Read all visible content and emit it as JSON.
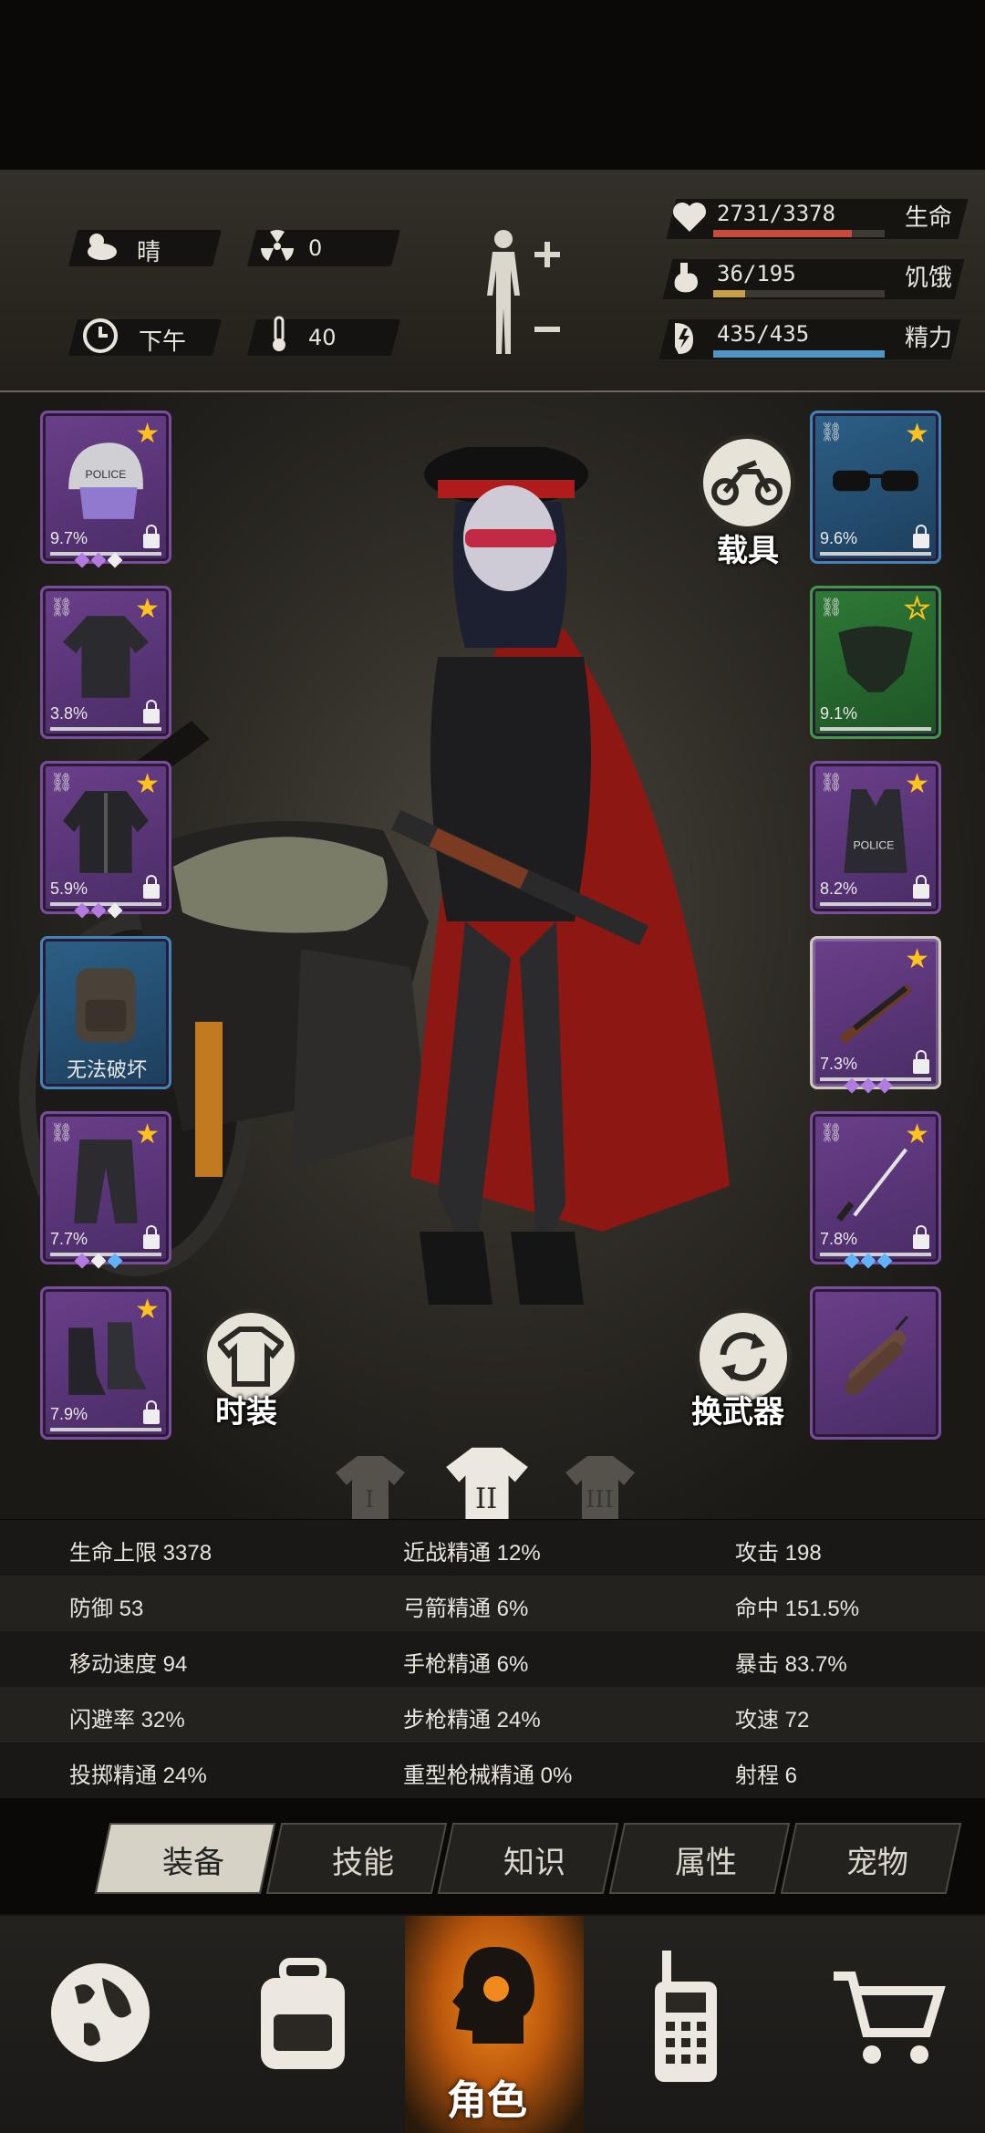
{
  "status": {
    "weather": {
      "icon": "cloud-sun-icon",
      "value": "晴"
    },
    "radiation": {
      "icon": "radiation-icon",
      "value": "0"
    },
    "time": {
      "icon": "clock-icon",
      "value": "下午"
    },
    "temperature": {
      "icon": "thermometer-icon",
      "value": "40"
    },
    "bars": [
      {
        "name": "health",
        "icon": "heart-icon",
        "value": "2731/3378",
        "label": "生命",
        "fraction": 0.808,
        "color": "#c84a3c"
      },
      {
        "name": "hunger",
        "icon": "stomach-icon",
        "value": "36/195",
        "label": "饥饿",
        "fraction": 0.185,
        "color": "#c9a04a"
      },
      {
        "name": "energy",
        "icon": "energy-icon",
        "value": "435/435",
        "label": "精力",
        "fraction": 1.0,
        "color": "#4f95c6"
      }
    ]
  },
  "left_slots": [
    {
      "name": "helmet",
      "pct": "9.7%",
      "rarity": "purple",
      "star": true,
      "gems": [
        "p",
        "p",
        "w"
      ],
      "icon": "helmet-icon"
    },
    {
      "name": "top",
      "pct": "3.8%",
      "rarity": "purple",
      "star": true,
      "gems": [],
      "icon": "shirt-icon"
    },
    {
      "name": "jacket",
      "pct": "5.9%",
      "rarity": "purple",
      "star": true,
      "gems": [
        "p",
        "p",
        "w"
      ],
      "icon": "jacket-icon"
    },
    {
      "name": "backpack",
      "pct": "",
      "rarity": "blue",
      "star": false,
      "label": "无法破坏",
      "gems": [],
      "icon": "backpack-icon"
    },
    {
      "name": "pants",
      "pct": "7.7%",
      "rarity": "purple",
      "star": true,
      "gems": [
        "p",
        "w",
        "b"
      ],
      "icon": "pants-icon"
    },
    {
      "name": "boots",
      "pct": "7.9%",
      "rarity": "purple",
      "star": true,
      "gems": [],
      "icon": "boots-icon"
    }
  ],
  "right_slots": [
    {
      "name": "glasses",
      "pct": "9.6%",
      "rarity": "blue",
      "star": true,
      "gems": [],
      "icon": "sunglasses-icon"
    },
    {
      "name": "mask",
      "pct": "9.1%",
      "rarity": "green",
      "star": false,
      "gems": [],
      "icon": "mask-icon"
    },
    {
      "name": "vest",
      "pct": "8.2%",
      "rarity": "purple",
      "star": true,
      "gems": [],
      "icon": "vest-icon"
    },
    {
      "name": "rifle",
      "pct": "7.3%",
      "rarity": "purple",
      "star": true,
      "gems": [
        "p",
        "p",
        "p"
      ],
      "icon": "rifle-icon"
    },
    {
      "name": "katana",
      "pct": "7.8%",
      "rarity": "purple",
      "star": true,
      "gems": [
        "b",
        "b",
        "b"
      ],
      "icon": "katana-icon"
    },
    {
      "name": "dynamite",
      "pct": "",
      "rarity": "purple",
      "star": false,
      "gems": [],
      "icon": "dynamite-icon"
    }
  ],
  "vest_text": "POLICE",
  "helmet_text": "POLICE",
  "buttons": {
    "vehicle": "载具",
    "fashion": "时装",
    "swap_weapon": "换武器"
  },
  "outfit_tabs": [
    "I",
    "II",
    "III"
  ],
  "stats": [
    [
      "生命上限 3378",
      "近战精通 12%",
      "攻击 198"
    ],
    [
      "防御 53",
      "弓箭精通 6%",
      "命中 151.5%"
    ],
    [
      "移动速度 94",
      "手枪精通 6%",
      "暴击 83.7%"
    ],
    [
      "闪避率 32%",
      "步枪精通 24%",
      "攻速 72"
    ],
    [
      "投掷精通 24%",
      "重型枪械精通 0%",
      "射程 6"
    ]
  ],
  "tabs": [
    {
      "label": "装备",
      "active": true
    },
    {
      "label": "技能",
      "active": false
    },
    {
      "label": "知识",
      "active": false
    },
    {
      "label": "属性",
      "active": false
    },
    {
      "label": "宠物",
      "active": false
    }
  ],
  "nav": [
    {
      "name": "world",
      "icon": "globe-icon"
    },
    {
      "name": "inventory",
      "icon": "backpack-icon"
    },
    {
      "name": "character",
      "icon": "character-head-icon",
      "label": "角色",
      "active": true
    },
    {
      "name": "radio",
      "icon": "walkie-talkie-icon"
    },
    {
      "name": "shop",
      "icon": "cart-icon"
    }
  ]
}
